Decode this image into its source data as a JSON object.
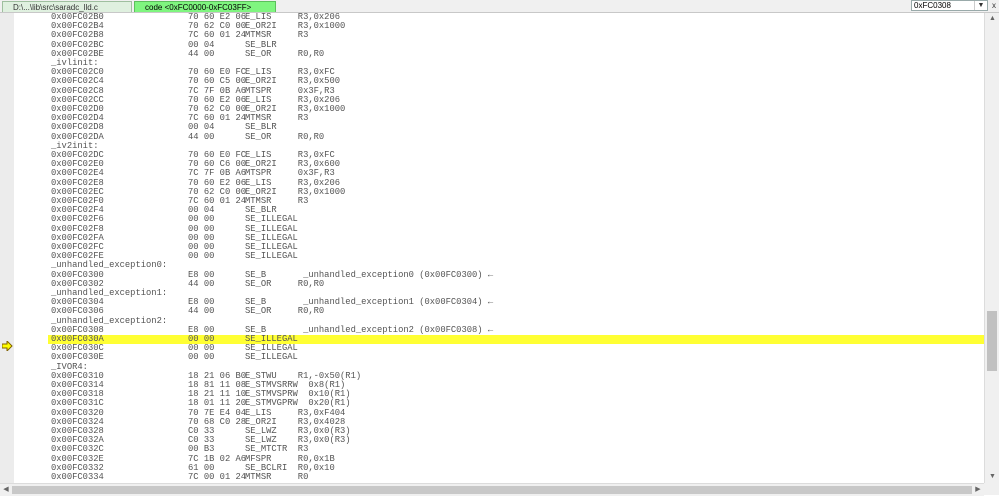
{
  "tabs": [
    {
      "label": "D:\\...\\lib\\src\\saradc_lld.c"
    },
    {
      "label": "code <0xFC0000-0xFC03FF>"
    }
  ],
  "address_input": {
    "value": "0xFC0308"
  },
  "close_glyph": "x",
  "dropdown_glyph": "▼",
  "colors": {
    "highlight": "#ffff33",
    "active_tab": "#7ff57f"
  },
  "current_line_index": 35,
  "lines": [
    {
      "t": "c",
      "a": "0x00FC02B0",
      "b": "70 60 E2 06",
      "i": "E_LIS     R3,0x206"
    },
    {
      "t": "c",
      "a": "0x00FC02B4",
      "b": "70 62 C0 00",
      "i": "E_OR2I    R3,0x1000"
    },
    {
      "t": "c",
      "a": "0x00FC02B8",
      "b": "7C 60 01 24",
      "i": "MTMSR     R3"
    },
    {
      "t": "c",
      "a": "0x00FC02BC",
      "b": "00 04",
      "i": "SE_BLR"
    },
    {
      "t": "c",
      "a": "0x00FC02BE",
      "b": "44 00",
      "i": "SE_OR     R0,R0"
    },
    {
      "t": "l",
      "l": "_ivlinit:"
    },
    {
      "t": "c",
      "a": "0x00FC02C0",
      "b": "70 60 E0 FC",
      "i": "E_LIS     R3,0xFC"
    },
    {
      "t": "c",
      "a": "0x00FC02C4",
      "b": "70 60 C5 00",
      "i": "E_OR2I    R3,0x500"
    },
    {
      "t": "c",
      "a": "0x00FC02C8",
      "b": "7C 7F 0B A6",
      "i": "MTSPR     0x3F,R3"
    },
    {
      "t": "c",
      "a": "0x00FC02CC",
      "b": "70 60 E2 06",
      "i": "E_LIS     R3,0x206"
    },
    {
      "t": "c",
      "a": "0x00FC02D0",
      "b": "70 62 C0 00",
      "i": "E_OR2I    R3,0x1000"
    },
    {
      "t": "c",
      "a": "0x00FC02D4",
      "b": "7C 60 01 24",
      "i": "MTMSR     R3"
    },
    {
      "t": "c",
      "a": "0x00FC02D8",
      "b": "00 04",
      "i": "SE_BLR"
    },
    {
      "t": "c",
      "a": "0x00FC02DA",
      "b": "44 00",
      "i": "SE_OR     R0,R0"
    },
    {
      "t": "l",
      "l": "_iv2init:"
    },
    {
      "t": "c",
      "a": "0x00FC02DC",
      "b": "70 60 E0 FC",
      "i": "E_LIS     R3,0xFC"
    },
    {
      "t": "c",
      "a": "0x00FC02E0",
      "b": "70 60 C6 00",
      "i": "E_OR2I    R3,0x600"
    },
    {
      "t": "c",
      "a": "0x00FC02E4",
      "b": "7C 7F 0B A6",
      "i": "MTSPR     0x3F,R3"
    },
    {
      "t": "c",
      "a": "0x00FC02E8",
      "b": "70 60 E2 06",
      "i": "E_LIS     R3,0x206"
    },
    {
      "t": "c",
      "a": "0x00FC02EC",
      "b": "70 62 C0 00",
      "i": "E_OR2I    R3,0x1000"
    },
    {
      "t": "c",
      "a": "0x00FC02F0",
      "b": "7C 60 01 24",
      "i": "MTMSR     R3"
    },
    {
      "t": "c",
      "a": "0x00FC02F4",
      "b": "00 04",
      "i": "SE_BLR"
    },
    {
      "t": "c",
      "a": "0x00FC02F6",
      "b": "00 00",
      "i": "SE_ILLEGAL"
    },
    {
      "t": "c",
      "a": "0x00FC02F8",
      "b": "00 00",
      "i": "SE_ILLEGAL"
    },
    {
      "t": "c",
      "a": "0x00FC02FA",
      "b": "00 00",
      "i": "SE_ILLEGAL"
    },
    {
      "t": "c",
      "a": "0x00FC02FC",
      "b": "00 00",
      "i": "SE_ILLEGAL"
    },
    {
      "t": "c",
      "a": "0x00FC02FE",
      "b": "00 00",
      "i": "SE_ILLEGAL"
    },
    {
      "t": "l",
      "l": "_unhandled_exception0:"
    },
    {
      "t": "c",
      "a": "0x00FC0300",
      "b": "E8 00",
      "i": "SE_B       _unhandled_exception0 (0x00FC0300) ←"
    },
    {
      "t": "c",
      "a": "0x00FC0302",
      "b": "44 00",
      "i": "SE_OR     R0,R0"
    },
    {
      "t": "l",
      "l": "_unhandled_exception1:"
    },
    {
      "t": "c",
      "a": "0x00FC0304",
      "b": "E8 00",
      "i": "SE_B       _unhandled_exception1 (0x00FC0304) ←"
    },
    {
      "t": "c",
      "a": "0x00FC0306",
      "b": "44 00",
      "i": "SE_OR     R0,R0"
    },
    {
      "t": "l",
      "l": "_unhandled_exception2:"
    },
    {
      "t": "c",
      "a": "0x00FC0308",
      "b": "E8 00",
      "i": "SE_B       _unhandled_exception2 (0x00FC0308) ←"
    },
    {
      "t": "c",
      "a": "0x00FC030A",
      "b": "00 00",
      "i": "SE_ILLEGAL"
    },
    {
      "t": "c",
      "a": "0x00FC030C",
      "b": "00 00",
      "i": "SE_ILLEGAL"
    },
    {
      "t": "c",
      "a": "0x00FC030E",
      "b": "00 00",
      "i": "SE_ILLEGAL"
    },
    {
      "t": "l",
      "l": "_IVOR4:"
    },
    {
      "t": "c",
      "a": "0x00FC0310",
      "b": "18 21 06 B0",
      "i": "E_STWU    R1,-0x50(R1)"
    },
    {
      "t": "c",
      "a": "0x00FC0314",
      "b": "18 81 11 08",
      "i": "E_STMVSRRW  0x8(R1)"
    },
    {
      "t": "c",
      "a": "0x00FC0318",
      "b": "18 21 11 10",
      "i": "E_STMVSPRW  0x10(R1)"
    },
    {
      "t": "c",
      "a": "0x00FC031C",
      "b": "18 01 11 20",
      "i": "E_STMVGPRW  0x20(R1)"
    },
    {
      "t": "c",
      "a": "0x00FC0320",
      "b": "70 7E E4 04",
      "i": "E_LIS     R3,0xF404"
    },
    {
      "t": "c",
      "a": "0x00FC0324",
      "b": "70 68 C0 28",
      "i": "E_OR2I    R3,0x4028"
    },
    {
      "t": "c",
      "a": "0x00FC0328",
      "b": "C0 33",
      "i": "SE_LWZ    R3,0x0(R3)"
    },
    {
      "t": "c",
      "a": "0x00FC032A",
      "b": "C0 33",
      "i": "SE_LWZ    R3,0x0(R3)"
    },
    {
      "t": "c",
      "a": "0x00FC032C",
      "b": "00 B3",
      "i": "SE_MTCTR  R3"
    },
    {
      "t": "c",
      "a": "0x00FC032E",
      "b": "7C 1B 02 A6",
      "i": "MFSPR     R0,0x1B"
    },
    {
      "t": "c",
      "a": "0x00FC0332",
      "b": "61 00",
      "i": "SE_BCLRI  R0,0x10"
    },
    {
      "t": "c",
      "a": "0x00FC0334",
      "b": "7C 00 01 24",
      "i": "MTMSR     R0"
    }
  ]
}
